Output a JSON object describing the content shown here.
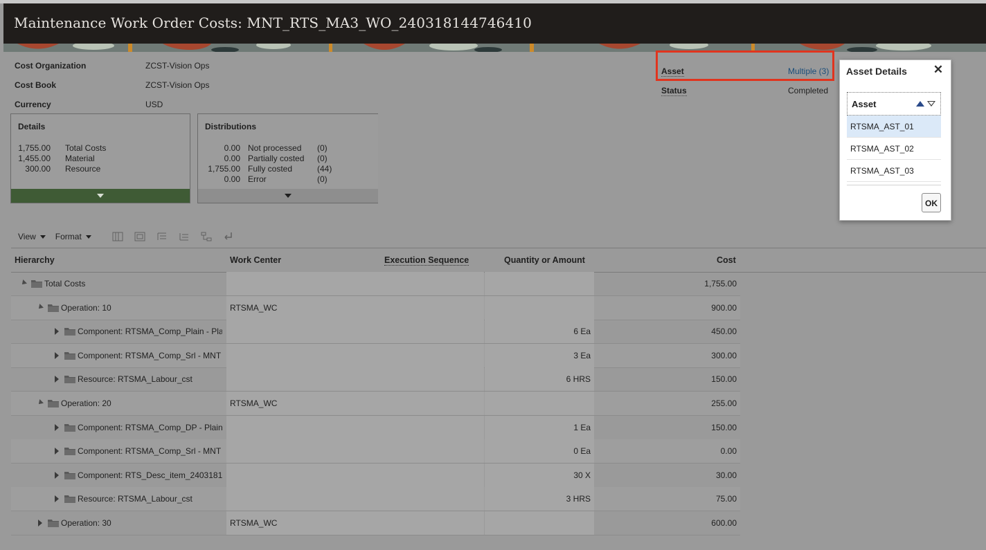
{
  "header": {
    "title": "Maintenance Work Order Costs: MNT_RTS_MA3_WO_240318144746410"
  },
  "info": {
    "cost_org_label": "Cost Organization",
    "cost_org_value": "ZCST-Vision Ops",
    "cost_book_label": "Cost Book",
    "cost_book_value": "ZCST-Vision Ops",
    "currency_label": "Currency",
    "currency_value": "USD",
    "asset_label": "Asset",
    "asset_value": "Multiple (3)",
    "status_label": "Status",
    "status_value": "Completed"
  },
  "details": {
    "title": "Details",
    "rows": [
      {
        "amount": "1,755.00",
        "label": "Total Costs"
      },
      {
        "amount": "1,455.00",
        "label": "Material"
      },
      {
        "amount": "300.00",
        "label": "Resource"
      }
    ]
  },
  "distributions": {
    "title": "Distributions",
    "rows": [
      {
        "amount": "0.00",
        "label": "Not processed",
        "count": "(0)"
      },
      {
        "amount": "0.00",
        "label": "Partially costed",
        "count": "(0)"
      },
      {
        "amount": "1,755.00",
        "label": "Fully costed",
        "count": "(44)"
      },
      {
        "amount": "0.00",
        "label": "Error",
        "count": "(0)"
      }
    ]
  },
  "toolbar": {
    "view": "View",
    "format": "Format"
  },
  "table": {
    "headers": {
      "hierarchy": "Hierarchy",
      "work_center": "Work Center",
      "exec_seq": "Execution Sequence",
      "qty": "Quantity or Amount",
      "cost": "Cost"
    },
    "rows": [
      {
        "label": "Total Costs",
        "work_center": "",
        "qty": "",
        "cost": "1,755.00"
      },
      {
        "label": "Operation: 10",
        "work_center": "RTSMA_WC",
        "qty": "",
        "cost": "900.00"
      },
      {
        "label": "Component: RTSMA_Comp_Plain - Pla",
        "work_center": "",
        "qty": "6 Ea",
        "cost": "450.00"
      },
      {
        "label": "Component: RTSMA_Comp_Srl - MNT",
        "work_center": "",
        "qty": "3 Ea",
        "cost": "300.00"
      },
      {
        "label": "Resource: RTSMA_Labour_cst",
        "work_center": "",
        "qty": "6 HRS",
        "cost": "150.00"
      },
      {
        "label": "Operation: 20",
        "work_center": "RTSMA_WC",
        "qty": "",
        "cost": "255.00"
      },
      {
        "label": "Component: RTSMA_Comp_DP - Plain",
        "work_center": "",
        "qty": "1 Ea",
        "cost": "150.00"
      },
      {
        "label": "Component: RTSMA_Comp_Srl - MNT",
        "work_center": "",
        "qty": "0 Ea",
        "cost": "0.00"
      },
      {
        "label": "Component: RTS_Desc_item_2403181",
        "work_center": "",
        "qty": "30 X",
        "cost": "30.00"
      },
      {
        "label": "Resource: RTSMA_Labour_cst",
        "work_center": "",
        "qty": "3 HRS",
        "cost": "75.00"
      },
      {
        "label": "Operation: 30",
        "work_center": "RTSMA_WC",
        "qty": "",
        "cost": "600.00"
      }
    ]
  },
  "dialog": {
    "title": "Asset Details",
    "close": "✕",
    "column": "Asset",
    "rows": [
      "RTSMA_AST_01",
      "RTSMA_AST_02",
      "RTSMA_AST_03"
    ],
    "ok": "OK"
  },
  "colors": {
    "accent": "#e1341e",
    "details_footer": "#3f5b35",
    "link": "#1b4e7a"
  }
}
